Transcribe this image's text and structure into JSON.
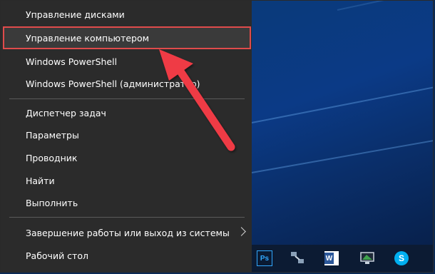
{
  "menu": {
    "items": [
      {
        "label": "Управление дисками"
      },
      {
        "label": "Управление компьютером"
      },
      {
        "label": "Windows PowerShell"
      },
      {
        "label": "Windows PowerShell (администратор)"
      },
      {
        "label": "Диспетчер задач"
      },
      {
        "label": "Параметры"
      },
      {
        "label": "Проводник"
      },
      {
        "label": "Найти"
      },
      {
        "label": "Выполнить"
      },
      {
        "label": "Завершение работы или выход из системы"
      },
      {
        "label": "Рабочий стол"
      }
    ]
  },
  "taskbar": {
    "apps": [
      {
        "name": "photoshop-icon",
        "label": "Ps"
      },
      {
        "name": "network-icon",
        "label": ""
      },
      {
        "name": "word-icon",
        "label": "W"
      },
      {
        "name": "monitor-icon",
        "label": ""
      },
      {
        "name": "skype-icon",
        "label": "S"
      }
    ]
  },
  "colors": {
    "menu_bg": "#2b2b2b",
    "highlight_border": "#e04b4b",
    "arrow": "#ef3b45",
    "taskbar_bg": "#0c1b33"
  }
}
